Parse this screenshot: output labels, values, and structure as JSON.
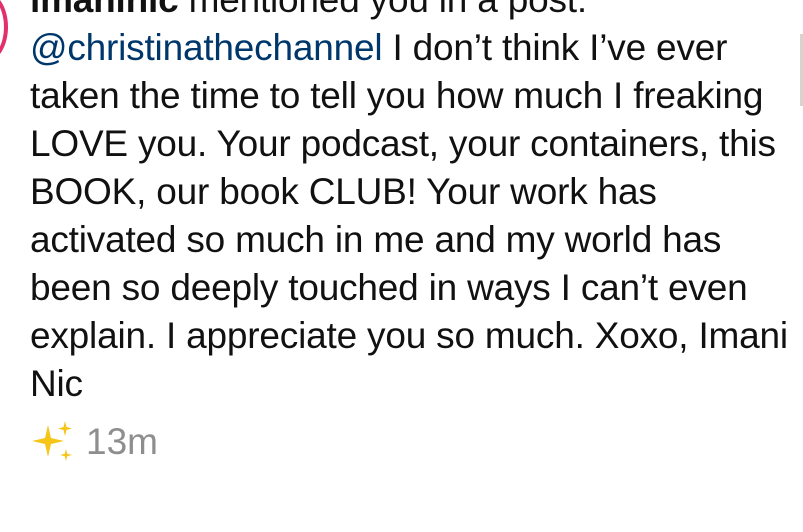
{
  "notification": {
    "username": "imaninic",
    "action": " mentioned you in a post: ",
    "mention": "@christinathechannel",
    "message": " I don’t think I’ve ever taken the time to tell you how much I freaking LOVE you. Your podcast, your containers, this BOOK, our book CLUB! Your work has activated so much in me and my world has been so deeply touched in ways I can’t even explain. I appreciate you so much. Xoxo, Imani Nic",
    "icon": "sparkles-icon",
    "timestamp": "13m"
  },
  "colors": {
    "mention": "#00376b",
    "timestamp": "#8e8e8e",
    "avatar_ring": "#e1306c",
    "sparkle": "#f5c518"
  }
}
